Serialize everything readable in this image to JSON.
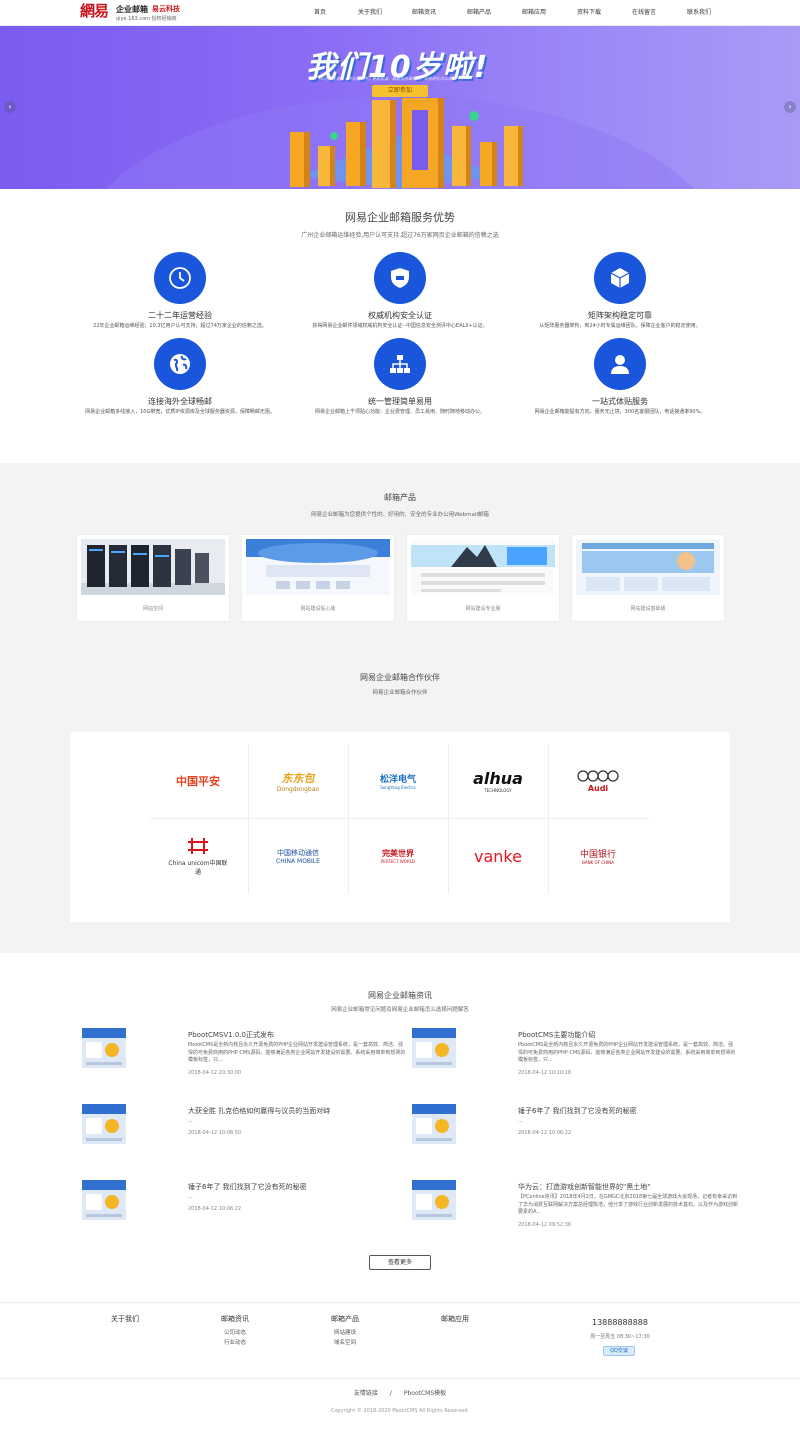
{
  "header": {
    "logo_mark": "網易",
    "logo_title": "企业邮箱",
    "logo_brand": "易云科技",
    "logo_sub": "qiye.163.com 授权经销商",
    "nav": [
      "首页",
      "关于我们",
      "邮箱资讯",
      "邮箱产品",
      "邮箱应用",
      "资料下载",
      "在线留言",
      "联系我们"
    ]
  },
  "banner": {
    "title": "我们10岁啦!",
    "subtitle": "云办公是潮流，不仅是顺中，更是机遇，随着信息革新日，云协同化办公未来",
    "button": "立即参加",
    "prev": "‹",
    "next": "›"
  },
  "advantages": {
    "title": "网易企业邮箱服务优势",
    "subtitle": "广州企业邮箱运维经验,用户认可支持,超过76万家网页企业邮箱的信赖之选",
    "items": [
      {
        "icon": "clock-icon",
        "title": "二十二年运营经验",
        "desc": "22年企业邮箱运维经验；10.3亿用户认可支持；超过74万家企业的信赖之选。"
      },
      {
        "icon": "shield-icon",
        "title": "权威机构安全认证",
        "desc": "获得网易企业邮件领域权威机构安全认证--中国信息安全测评中心EAL3+认证。"
      },
      {
        "icon": "cube-icon",
        "title": "矩阵架构稳定可靠",
        "desc": "从矩阵服务器架构，到24小时专属运维团队，保障企业客户的稳定使用。"
      },
      {
        "icon": "globe-icon",
        "title": "连接海外全球畅邮",
        "desc": "网易企业邮箱多线接入，10G带宽，优质IP资源库及全球服务器资源，保障畅邮无阻。"
      },
      {
        "icon": "hierarchy-icon",
        "title": "统一管理简单易用",
        "desc": "网易企业邮箱上千项贴心功能：企业费管理、员工易用、随时随地移动办公。"
      },
      {
        "icon": "user-icon",
        "title": "一站式体贴服务",
        "desc": "网易企业邮箱能提有方向，服务无止境，300名客服团队，电话接通率90%。"
      }
    ]
  },
  "products": {
    "title": "邮箱产品",
    "subtitle": "网易企业邮箱为您提供个性的、好用的、安全的专业办公用Webmail邮箱",
    "items": [
      {
        "label": "网站空间"
      },
      {
        "label": "网站建设贴心版"
      },
      {
        "label": "网站建设专业版"
      },
      {
        "label": "网站建设基础版"
      }
    ]
  },
  "partners": {
    "title": "网易企业邮箱合作伙伴",
    "subtitle": "网易企业邮箱合作伙伴",
    "logos": [
      {
        "name": "中国平安",
        "sub": "",
        "color": "#e8401c"
      },
      {
        "name": "东东包",
        "sub": "Dongdongbao",
        "color": "#e8a21c"
      },
      {
        "name": "松洋电气",
        "sub": "SongYang Electric",
        "color": "#1a6fc4"
      },
      {
        "name": "alhua",
        "sub": "TECHNOLOGY",
        "color": "#111111"
      },
      {
        "name": "Audi",
        "sub": "",
        "color": "#c8161e"
      },
      {
        "name": "China unicom中国联通",
        "sub": "",
        "color": "#d8141e"
      },
      {
        "name": "中国移动通信",
        "sub": "CHINA MOBILE",
        "color": "#1a4d9e"
      },
      {
        "name": "完美世界",
        "sub": "PERFECT WORLD",
        "color": "#c8161e"
      },
      {
        "name": "vanke",
        "sub": "",
        "color": "#e8141e"
      },
      {
        "name": "中国银行",
        "sub": "BANK OF CHINA",
        "color": "#b0121e"
      }
    ]
  },
  "news": {
    "title": "网易企业邮箱资讯",
    "subtitle": "网易企业邮箱常见问题及网易企业邮箱怎么选择问题解答",
    "items": [
      {
        "title": "PbootCMSV1.0.0正式发布",
        "desc": "PbootCMS是全新内核且永久开源免费的PHP企业网站开发建设管理系统，是一套高效、简洁、强悍的可免费商用的PHP CMS源码，能够满足各类企业网站开发建设的需要。系统采用简单到想哭的模板标签，只...",
        "date": "2018-04-12 20:30:00"
      },
      {
        "title": "PbootCMS主要功能介绍",
        "desc": "PbootCMS是全新内核且永久开源免费的PHP企业网站开发建设管理系统，是一套高效、简洁、强悍的可免费商用的PHP CMS源码，能够满足各类企业网站开发建设的需要。系统采用简单到想哭的模板标签，只...",
        "date": "2018-04-12 10:10:18"
      },
      {
        "title": "大获全胜 扎克伯格如何赢得与议员的当面对峙",
        "desc": "...",
        "date": "2018-04-12 10:08:50"
      },
      {
        "title": "锤子6年了 我们找到了它没有死的秘密",
        "desc": "...",
        "date": "2018-04-12 10:06:22"
      },
      {
        "title": "锤子6年了 我们找到了它没有死的秘密",
        "desc": "...",
        "date": "2018-04-12 10:06:22"
      },
      {
        "title": "华为云：打造游戏创新智能世界的\"黑土地\"",
        "desc": "【PConline资讯】2018年4月2日，在GMGC北京2018第七届全球游戏大会现场，记者有幸采访到了华为消费互联网解决方案总经理陈浩，他分享了游戏行业创新发展的技术基石，以及作为游戏创新要素的A...",
        "date": "2018-04-12 09:52:36"
      }
    ],
    "more": "查看更多"
  },
  "footer": {
    "cols": [
      {
        "heading": "关于我们",
        "items": []
      },
      {
        "heading": "邮箱资讯",
        "items": [
          "公司动态",
          "行业动态"
        ]
      },
      {
        "heading": "邮箱产品",
        "items": [
          "网站建设",
          "域名空间"
        ]
      },
      {
        "heading": "邮箱应用",
        "items": []
      }
    ],
    "phone": "13888888888",
    "hours": "周一至周五 08:30~17:30",
    "qq": "QQ交谈",
    "links_label": "友情链接",
    "links_sep": "/",
    "link1": "PbootCMS模板",
    "copyright": "Copyright © 2018-2020 PbootCMS All Rights Reserved."
  },
  "colors": {
    "accent": "#1a56db",
    "brand_red": "#c8161e",
    "banner": "#8a6cf5"
  }
}
